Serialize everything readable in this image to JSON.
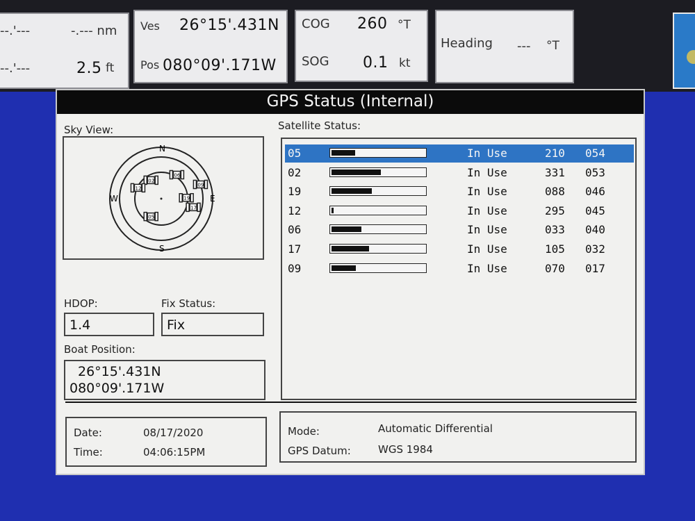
{
  "top_bar": {
    "box1": {
      "row1_left": "--.'---",
      "row1_right": "-.--- nm",
      "row2_left": "--.'---",
      "row2_value": "2.5",
      "row2_unit": "ft"
    },
    "position": {
      "lat_label": "Ves",
      "lat": "26°15'.431N",
      "lon_label": "Pos",
      "lon": "080°09'.171W"
    },
    "course": {
      "cog_label": "COG",
      "cog_value": "260",
      "cog_unit": "°T",
      "sog_label": "SOG",
      "sog_value": "0.1",
      "sog_unit": "kt"
    },
    "heading": {
      "label": "Heading",
      "value": "---",
      "unit": "°T"
    }
  },
  "dialog": {
    "title": "GPS Status (Internal)",
    "sky_view_label": "Sky View:",
    "compass": {
      "n": "N",
      "s": "S",
      "e": "E",
      "w": "W"
    },
    "sky_satellites": [
      "02",
      "05",
      "09",
      "12",
      "17",
      "06",
      "19"
    ],
    "satellite_status_label": "Satellite Status:",
    "satellites": [
      {
        "id": "05",
        "signal": 0.25,
        "status": "In Use",
        "azimuth": "210",
        "elevation": "054",
        "selected": true
      },
      {
        "id": "02",
        "signal": 0.53,
        "status": "In Use",
        "azimuth": "331",
        "elevation": "053",
        "selected": false
      },
      {
        "id": "19",
        "signal": 0.43,
        "status": "In Use",
        "azimuth": "088",
        "elevation": "046",
        "selected": false
      },
      {
        "id": "12",
        "signal": 0.02,
        "status": "In Use",
        "azimuth": "295",
        "elevation": "045",
        "selected": false
      },
      {
        "id": "06",
        "signal": 0.32,
        "status": "In Use",
        "azimuth": "033",
        "elevation": "040",
        "selected": false
      },
      {
        "id": "17",
        "signal": 0.4,
        "status": "In Use",
        "azimuth": "105",
        "elevation": "032",
        "selected": false
      },
      {
        "id": "09",
        "signal": 0.26,
        "status": "In Use",
        "azimuth": "070",
        "elevation": "017",
        "selected": false
      }
    ],
    "hdop_label": "HDOP:",
    "hdop_value": "1.4",
    "fix_status_label": "Fix Status:",
    "fix_status_value": "Fix",
    "boat_position_label": "Boat Position:",
    "boat_lat": "26°15'.431N",
    "boat_lon": "080°09'.171W",
    "date_label": "Date:",
    "date_value": "08/17/2020",
    "time_label": "Time:",
    "time_value": "04:06:15PM",
    "mode_label": "Mode:",
    "mode_value": "Automatic Differential",
    "datum_label": "GPS Datum:",
    "datum_value": "WGS 1984"
  },
  "colors": {
    "screen_bg": "#1f2fb0",
    "title_bar": "#0b0b0b",
    "selected_row": "#2e74c4",
    "panel_bg": "#f1f1ef"
  }
}
